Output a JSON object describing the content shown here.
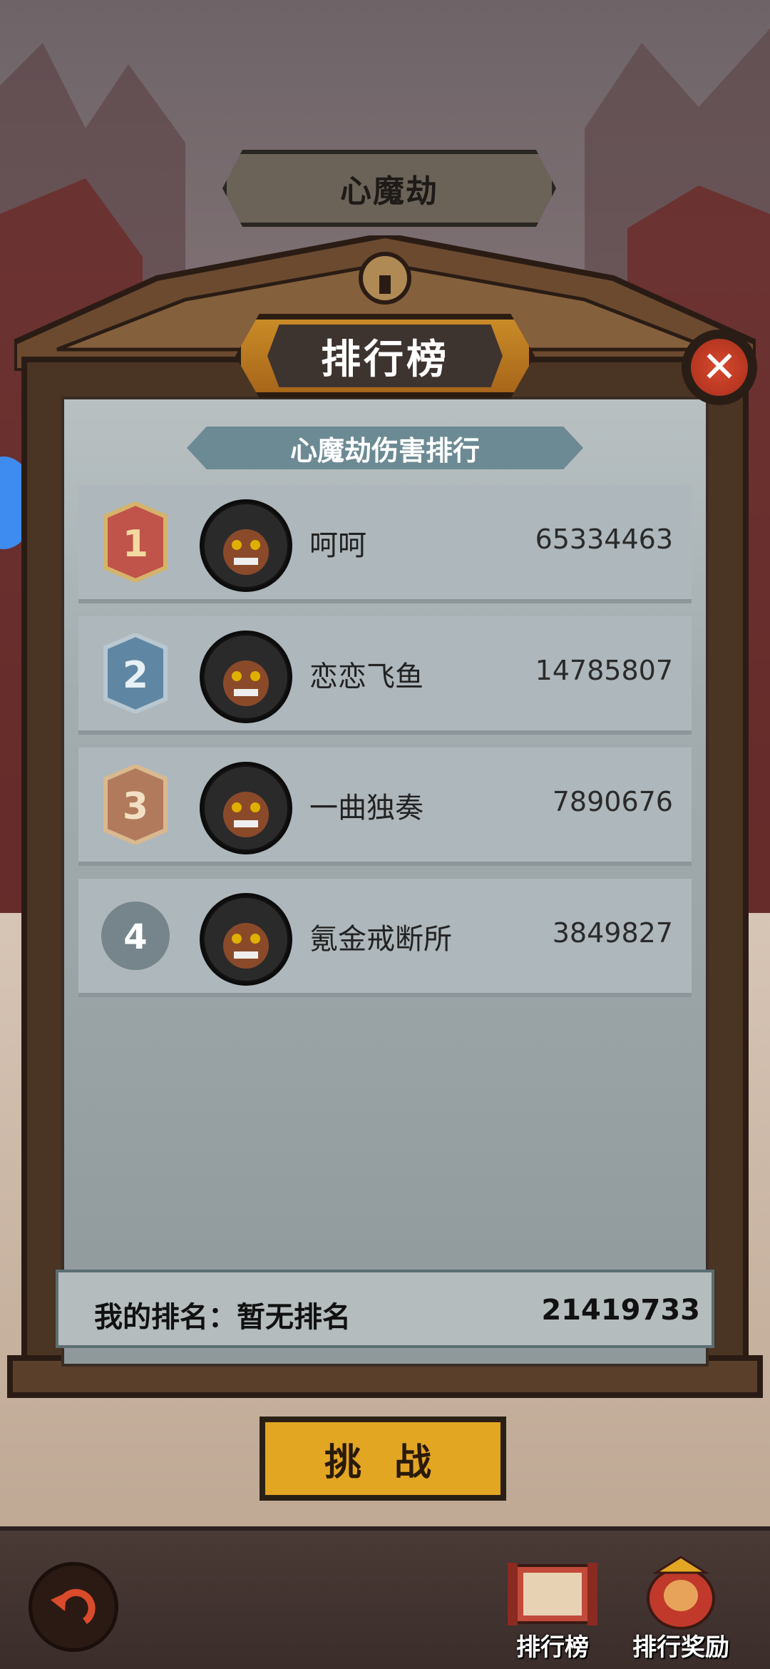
{
  "event": {
    "title": "心魔劫"
  },
  "leaderboard": {
    "title": "排行榜",
    "subtitle": "心魔劫伤害排行",
    "close_icon": "close-x-icon",
    "entries": [
      {
        "rank": "1",
        "name": "呵呵",
        "score": "65334463"
      },
      {
        "rank": "2",
        "name": "恋恋飞鱼",
        "score": "14785807"
      },
      {
        "rank": "3",
        "name": "一曲独奏",
        "score": "7890676"
      },
      {
        "rank": "4",
        "name": "氪金戒断所",
        "score": "3849827"
      }
    ],
    "my_rank": {
      "label": "我的排名：",
      "value": "暂无排名",
      "score": "21419733"
    }
  },
  "actions": {
    "challenge": "挑 战"
  },
  "nav": {
    "back_icon": "back-arrow-icon",
    "leaderboard_label": "排行榜",
    "rewards_label": "排行奖励"
  },
  "colors": {
    "rank1": "#c0534a",
    "rank2": "#5f87a3",
    "rank3": "#b27a5c",
    "rank4": "#6f7f86",
    "accent_gold": "#e2a623"
  }
}
